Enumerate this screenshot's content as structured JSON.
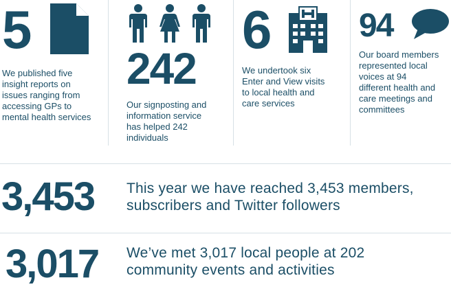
{
  "colors": {
    "primary": "#1b4e66",
    "divider": "#d6e0e5",
    "background": "#ffffff"
  },
  "stats": [
    {
      "number": "5",
      "icon": "document-icon",
      "text_lines": [
        "We published five",
        "insight reports on",
        "issues ranging from",
        "accessing GPs to",
        "mental health services"
      ]
    },
    {
      "number": "242",
      "icon": "people-icon",
      "text_lines": [
        "Our signposting and",
        "information service",
        "has helped 242",
        "individuals"
      ]
    },
    {
      "number": "6",
      "icon": "hospital-icon",
      "text_lines": [
        "We undertook six",
        "Enter and View visits",
        "to local health and",
        "care services"
      ]
    },
    {
      "number": "94",
      "icon": "speech-bubble-icon",
      "text_lines": [
        "Our board members",
        "represented local",
        "voices at 94",
        "different health and",
        "care meetings and",
        "committees"
      ]
    }
  ],
  "wide_stats": [
    {
      "number": "3,453",
      "text_lines": [
        "This year we have reached 3,453 members,",
        "subscribers and Twitter followers"
      ]
    },
    {
      "number": "3,017",
      "text_lines": [
        "We’ve met 3,017 local people at 202",
        "community events and activities"
      ]
    }
  ]
}
